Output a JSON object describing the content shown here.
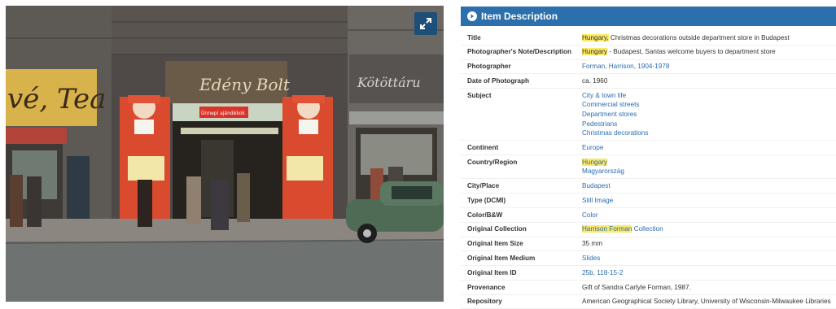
{
  "photo": {
    "expand_icon": "expand-arrows-icon",
    "sign_left": "vé, Tea",
    "sign_center": "Edény Bolt",
    "sign_right": "Kötöttáru",
    "banner_text": "Ünnepi ajándékok"
  },
  "header": {
    "icon": "info-circle-icon",
    "title": "Item Description"
  },
  "fields": {
    "title": {
      "label": "Title",
      "highlight": "Hungary,",
      "rest": " Christmas decorations outside department store in Budapest"
    },
    "note": {
      "label": "Photographer's Note/Description",
      "highlight": "Hungary",
      "rest": " - Budapest, Santas welcome buyers to department store"
    },
    "photographer": {
      "label": "Photographer",
      "value": "Forman, Harrison, 1904-1978"
    },
    "date": {
      "label": "Date of Photograph",
      "value": "ca. 1960"
    },
    "subject": {
      "label": "Subject",
      "values": [
        "City & town life",
        "Commercial streets",
        "Department stores",
        "Pedestrians",
        "Christmas decorations"
      ]
    },
    "continent": {
      "label": "Continent",
      "value": "Europe"
    },
    "country": {
      "label": "Country/Region",
      "highlight": "Hungary",
      "value2": "Magyarország"
    },
    "city": {
      "label": "City/Place",
      "value": "Budapest"
    },
    "type": {
      "label": "Type (DCMI)",
      "value": "Still Image"
    },
    "color": {
      "label": "Color/B&W",
      "value": "Color"
    },
    "collection": {
      "label": "Original Collection",
      "highlight": "Harrison Forman",
      "rest": " Collection"
    },
    "size": {
      "label": "Original Item Size",
      "value": "35 mm"
    },
    "medium": {
      "label": "Original Item Medium",
      "value": "Slides"
    },
    "item_id": {
      "label": "Original Item ID",
      "value": "25b, 118-15-2"
    },
    "provenance": {
      "label": "Provenance",
      "value": "Gift of Sandra Carlyle Forman, 1987."
    },
    "repository": {
      "label": "Repository",
      "value": "American Geographical Society Library, University of Wisconsin-Milwaukee Libraries"
    }
  }
}
